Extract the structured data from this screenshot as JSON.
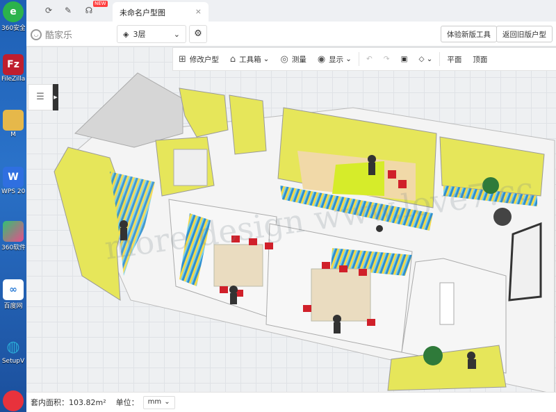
{
  "desktop": {
    "icons": [
      {
        "label": "360安全",
        "icon": "360-browser-icon",
        "color": "#2bb24c",
        "glyph": "e"
      },
      {
        "label": "FileZilla",
        "icon": "filezilla-icon",
        "color": "#bf1e2e",
        "glyph": "Fz"
      },
      {
        "label": "M",
        "icon": "folder-icon",
        "color": "#e6b84a",
        "glyph": ""
      },
      {
        "label": "WPS 20",
        "icon": "wps-icon",
        "color": "#2f6fe0",
        "glyph": "W"
      },
      {
        "label": "360软件",
        "icon": "360-software-icon",
        "color": "#32c074",
        "glyph": ""
      },
      {
        "label": "百度网",
        "icon": "baidu-netdisk-icon",
        "color": "#ffffff",
        "glyph": "∞"
      },
      {
        "label": "SetupV",
        "icon": "setup-icon",
        "color": "#2aa8d6",
        "glyph": "◍"
      }
    ]
  },
  "tabs": {
    "new_badge": "NEW",
    "active_title": "未命名户型图",
    "close_glyph": "×"
  },
  "topbar": {
    "logo_text": "酷家乐",
    "floor_label": "3层",
    "btn_new_tool": "体验新版工具",
    "btn_old": "返回旧版户型"
  },
  "toolbar": {
    "edit_floorplan": "修改户型",
    "toolbox": "工具箱",
    "measure": "测量",
    "display": "显示",
    "view_2d": "平面",
    "view_top": "顶面"
  },
  "status": {
    "area_label": "套内面积：103.82m²",
    "unit_label": "单位：",
    "unit_value": "mm"
  },
  "watermark": "more design www.love7.cc",
  "colors": {
    "accent_yellow": "#e9e94a",
    "floor_light": "#f3f3f3",
    "wall_gray": "#c8c8c8"
  }
}
